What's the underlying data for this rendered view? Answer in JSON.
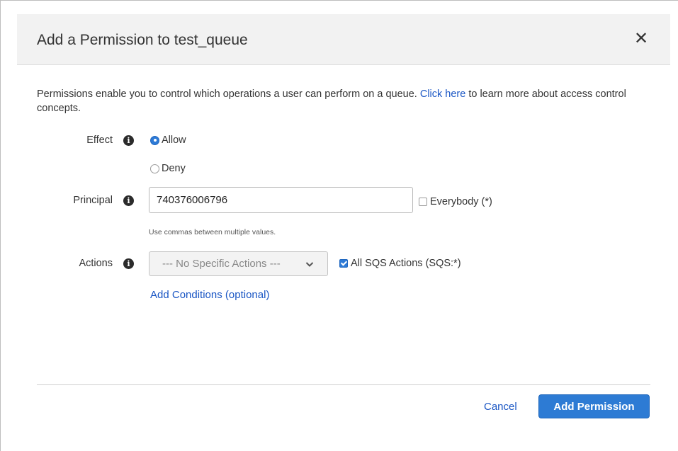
{
  "dialog": {
    "title": "Add a Permission to test_queue",
    "close_icon": "close-icon",
    "intro": {
      "text_before": "Permissions enable you to control which operations a user can perform on a queue.",
      "link_text": "Click here",
      "text_after": "to learn more about access control concepts."
    }
  },
  "form": {
    "effect": {
      "label": "Effect",
      "info_icon": "info-icon",
      "options": [
        {
          "label": "Allow",
          "selected": true
        },
        {
          "label": "Deny",
          "selected": false
        }
      ]
    },
    "principal": {
      "label": "Principal",
      "info_icon": "info-icon",
      "value": "740376006796",
      "everybody_label": "Everybody (*)",
      "everybody_checked": false,
      "hint": "Use commas between multiple values."
    },
    "actions": {
      "label": "Actions",
      "info_icon": "info-icon",
      "selected": "--- No Specific Actions ---",
      "all_label": "All SQS Actions (SQS:*)",
      "all_checked": true,
      "dropdown_icon": "chevron-down-icon"
    },
    "add_conditions": "Add Conditions (optional)"
  },
  "footer": {
    "cancel_label": "Cancel",
    "submit_label": "Add Permission"
  },
  "colors": {
    "accent": "#2d7bd4",
    "link": "#1a56c4",
    "header_bg": "#f2f2f2"
  }
}
